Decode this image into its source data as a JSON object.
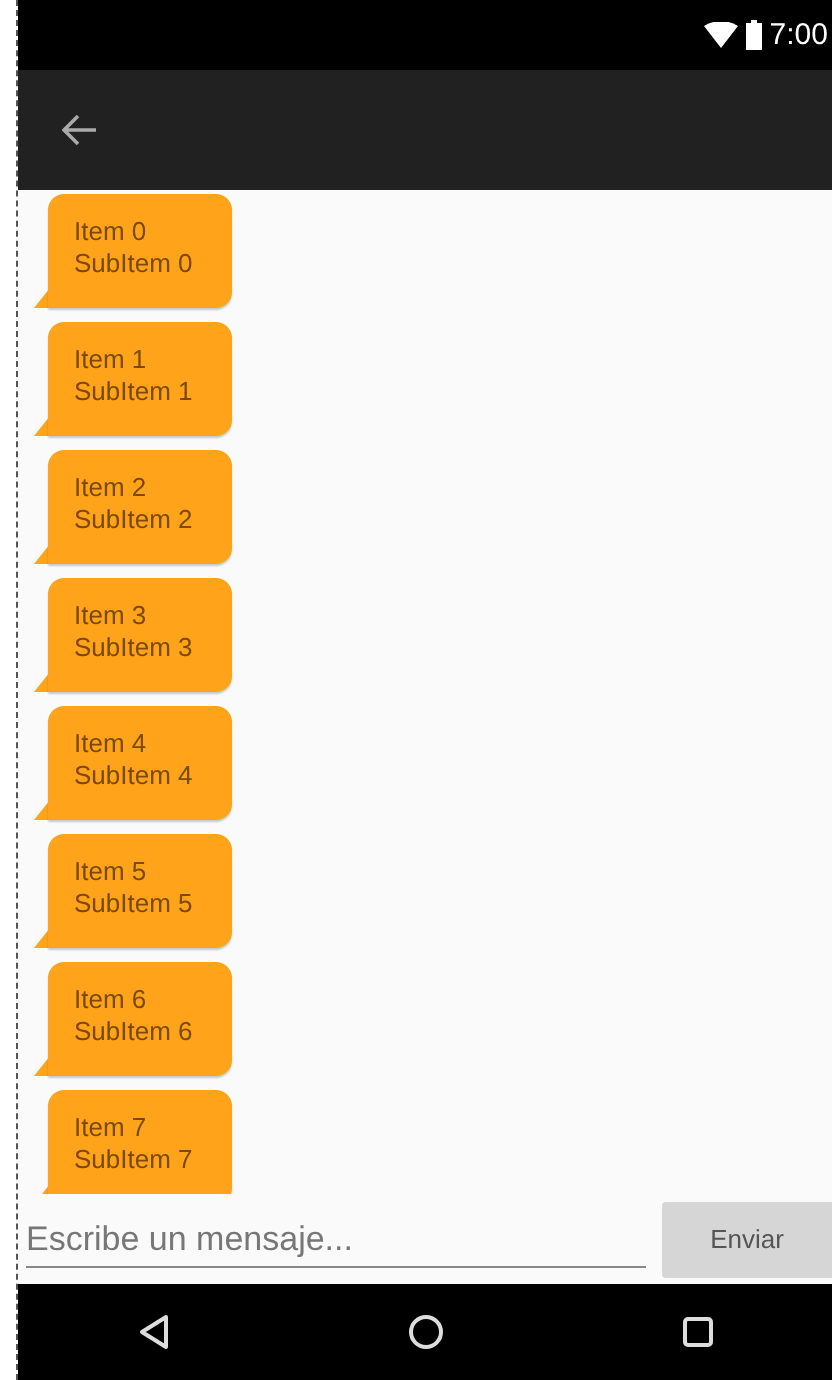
{
  "status_bar": {
    "time": "7:00"
  },
  "messages": [
    {
      "title": "Item 0",
      "subtitle": "SubItem 0"
    },
    {
      "title": "Item 1",
      "subtitle": "SubItem 1"
    },
    {
      "title": "Item 2",
      "subtitle": "SubItem 2"
    },
    {
      "title": "Item 3",
      "subtitle": "SubItem 3"
    },
    {
      "title": "Item 4",
      "subtitle": "SubItem 4"
    },
    {
      "title": "Item 5",
      "subtitle": "SubItem 5"
    },
    {
      "title": "Item 6",
      "subtitle": "SubItem 6"
    },
    {
      "title": "Item 7",
      "subtitle": "SubItem 7"
    }
  ],
  "composer": {
    "placeholder": "Escribe un mensaje...",
    "send_button": "Enviar"
  }
}
